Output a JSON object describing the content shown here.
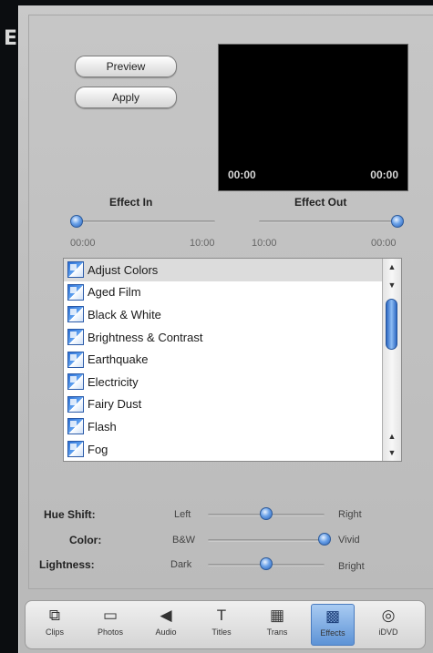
{
  "desktop": {
    "edge_letter": "E"
  },
  "buttons": {
    "preview": "Preview",
    "apply": "Apply"
  },
  "monitor": {
    "time_left": "00:00",
    "time_right": "00:00"
  },
  "effect_in": {
    "label": "Effect In",
    "start": "00:00",
    "end": "10:00",
    "value": 0.0
  },
  "effect_out": {
    "label": "Effect Out",
    "start": "10:00",
    "end": "00:00",
    "value": 1.0
  },
  "effects_list": {
    "items": [
      "Adjust Colors",
      "Aged Film",
      "Black & White",
      "Brightness & Contrast",
      "Earthquake",
      "Electricity",
      "Fairy Dust",
      "Flash",
      "Fog"
    ],
    "selected_index": 0,
    "scroll_up_glyph": "▲",
    "scroll_down_glyph": "▼"
  },
  "adjustments": {
    "hue_shift": {
      "label": "Hue Shift:",
      "min": "Left",
      "max": "Right",
      "value": 0.5
    },
    "color": {
      "label": "Color:",
      "min": "B&W",
      "max": "Vivid",
      "value": 1.0
    },
    "lightness": {
      "label": "Lightness:",
      "min": "Dark",
      "max": "Bright",
      "value": 0.5
    }
  },
  "toolbar": {
    "tabs": [
      {
        "label": "Clips",
        "icon": "clips-icon",
        "glyph": "⧉"
      },
      {
        "label": "Photos",
        "icon": "photos-icon",
        "glyph": "▭"
      },
      {
        "label": "Audio",
        "icon": "audio-icon",
        "glyph": "◀"
      },
      {
        "label": "Titles",
        "icon": "titles-icon",
        "glyph": "T"
      },
      {
        "label": "Trans",
        "icon": "transitions-icon",
        "glyph": "▦"
      },
      {
        "label": "Effects",
        "icon": "effects-icon",
        "glyph": "▩"
      },
      {
        "label": "iDVD",
        "icon": "idvd-icon",
        "glyph": "◎"
      }
    ],
    "active": "Effects"
  },
  "colors": {
    "accent": "#5d93d6",
    "panel": "#c4c4c4",
    "monitor": "#000000"
  }
}
